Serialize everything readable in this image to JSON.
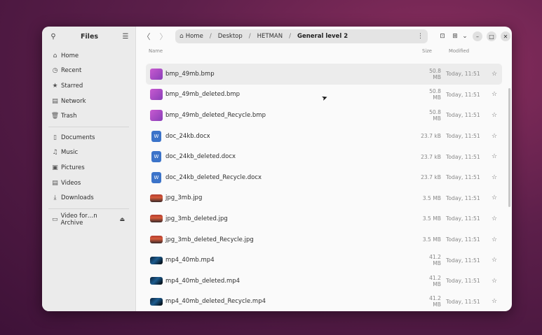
{
  "sidebar": {
    "title": "Files",
    "search_icon": "search-icon",
    "menu_icon": "hamburger-menu-icon",
    "items": [
      {
        "label": "Home",
        "icon": "⌂"
      },
      {
        "label": "Recent",
        "icon": "◷"
      },
      {
        "label": "Starred",
        "icon": "★"
      },
      {
        "label": "Network",
        "icon": "▤"
      },
      {
        "label": "Trash",
        "icon": "🗑"
      }
    ],
    "places": [
      {
        "label": "Documents",
        "icon": "▯"
      },
      {
        "label": "Music",
        "icon": "♫"
      },
      {
        "label": "Pictures",
        "icon": "▣"
      },
      {
        "label": "Videos",
        "icon": "▤"
      },
      {
        "label": "Downloads",
        "icon": "⤓"
      }
    ],
    "mount": {
      "label": "Video for…n Archive",
      "icon": "▭",
      "eject": "⏏"
    }
  },
  "toolbar": {
    "back": "〈",
    "forward": "〉",
    "path": [
      "Home",
      "Desktop",
      "HETMAN",
      "General level 2"
    ],
    "path_separator": "/",
    "path_menu": "⋮",
    "new_folder_icon": "⊡",
    "view_icon": "⊞",
    "view_dropdown": "⌄",
    "minimize": "–",
    "maximize": "□",
    "close": "✕"
  },
  "columns": {
    "name": "Name",
    "size": "Size",
    "modified": "Modified"
  },
  "files": [
    {
      "name": "bmp_49mb.bmp",
      "size": "50.8 MB",
      "modified": "Today, 11:51",
      "type": "bmp"
    },
    {
      "name": "bmp_49mb_deleted.bmp",
      "size": "50.8 MB",
      "modified": "Today, 11:51",
      "type": "bmp"
    },
    {
      "name": "bmp_49mb_deleted_Recycle.bmp",
      "size": "50.8 MB",
      "modified": "Today, 11:51",
      "type": "bmp"
    },
    {
      "name": "doc_24kb.docx",
      "size": "23.7 kB",
      "modified": "Today, 11:51",
      "type": "doc"
    },
    {
      "name": "doc_24kb_deleted.docx",
      "size": "23.7 kB",
      "modified": "Today, 11:51",
      "type": "doc"
    },
    {
      "name": "doc_24kb_deleted_Recycle.docx",
      "size": "23.7 kB",
      "modified": "Today, 11:51",
      "type": "doc"
    },
    {
      "name": "jpg_3mb.jpg",
      "size": "3.5 MB",
      "modified": "Today, 11:51",
      "type": "jpg"
    },
    {
      "name": "jpg_3mb_deleted.jpg",
      "size": "3.5 MB",
      "modified": "Today, 11:51",
      "type": "jpg"
    },
    {
      "name": "jpg_3mb_deleted_Recycle.jpg",
      "size": "3.5 MB",
      "modified": "Today, 11:51",
      "type": "jpg"
    },
    {
      "name": "mp4_40mb.mp4",
      "size": "41.2 MB",
      "modified": "Today, 11:51",
      "type": "mp4"
    },
    {
      "name": "mp4_40mb_deleted.mp4",
      "size": "41.2 MB",
      "modified": "Today, 11:51",
      "type": "mp4"
    },
    {
      "name": "mp4_40mb_deleted_Recycle.mp4",
      "size": "41.2 MB",
      "modified": "Today, 11:51",
      "type": "mp4"
    }
  ],
  "star_icon": "☆"
}
